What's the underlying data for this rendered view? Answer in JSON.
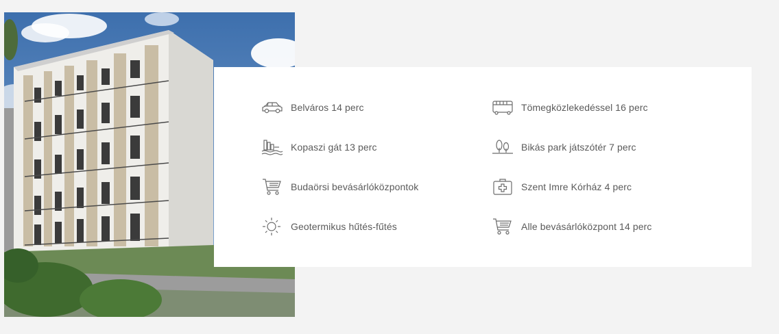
{
  "amenities": {
    "left": [
      {
        "icon": "car-icon",
        "label": "Belváros 14 perc"
      },
      {
        "icon": "riverside-icon",
        "label": "Kopaszi gát 13 perc"
      },
      {
        "icon": "shopping-cart-icon",
        "label": "Budaörsi bevásárlóközpontok"
      },
      {
        "icon": "sun-icon",
        "label": "Geotermikus hűtés-fűtés"
      }
    ],
    "right": [
      {
        "icon": "bus-icon",
        "label": "Tömegközlekedéssel 16 perc"
      },
      {
        "icon": "trees-icon",
        "label": "Bikás park játszótér 7 perc"
      },
      {
        "icon": "medical-kit-icon",
        "label": "Szent Imre Kórház 4 perc"
      },
      {
        "icon": "shopping-cart-icon",
        "label": "Alle bevásárlóközpont 14 perc"
      }
    ]
  },
  "colors": {
    "page_background": "#f3f3f3",
    "card_background": "#ffffff",
    "text": "#5a5a5a",
    "icon_stroke": "#6b6b6b",
    "sky": "#4f7fb8"
  }
}
